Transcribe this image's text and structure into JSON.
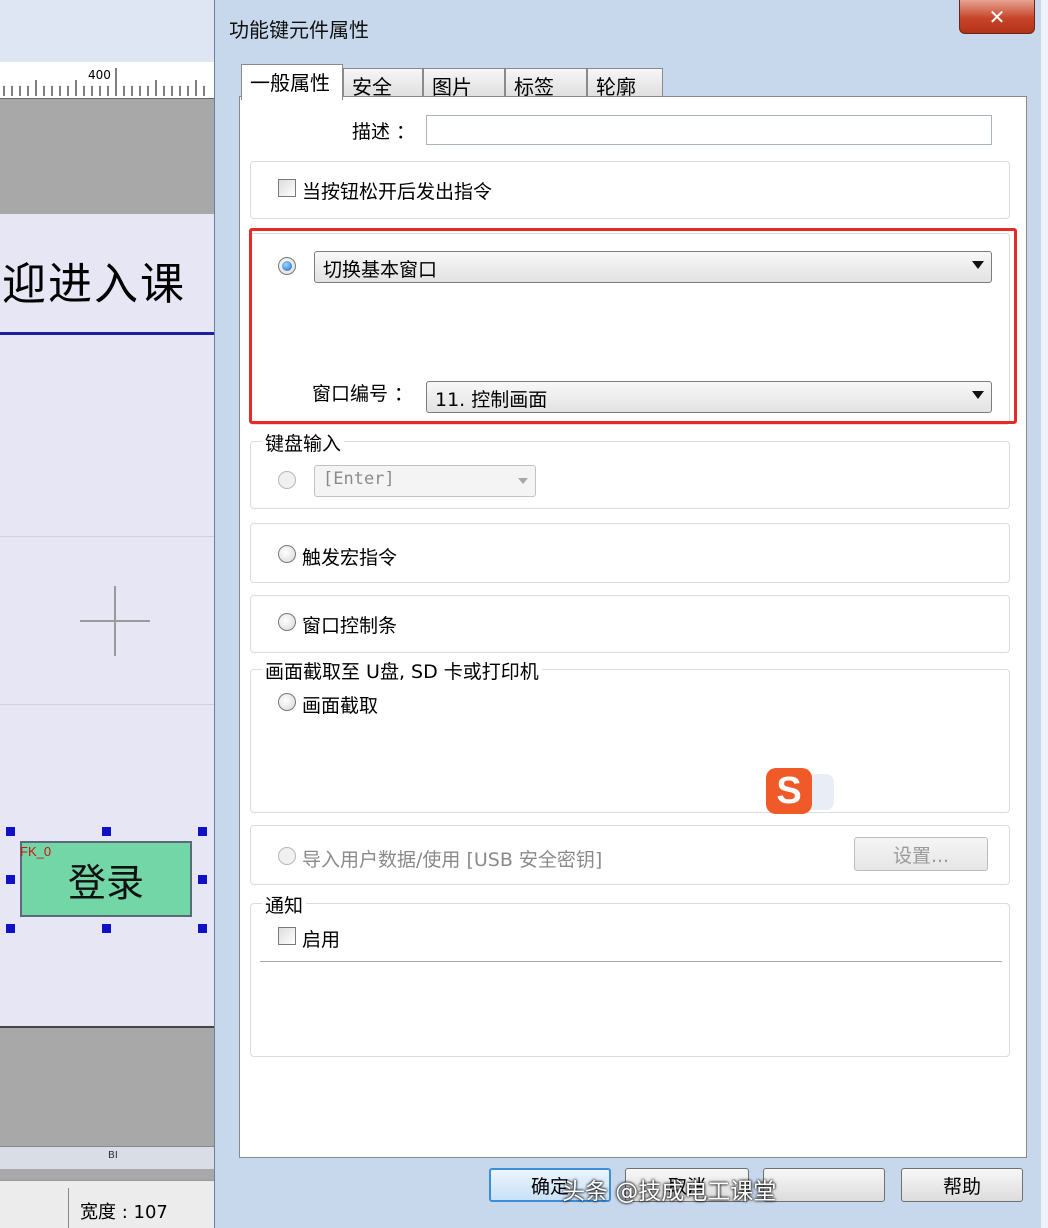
{
  "editor": {
    "ruler_label": "400",
    "canvas_title": "迎进入课",
    "button_tag": "FK_0",
    "button_label": "登录",
    "bottom_label": "BI",
    "status_text": "宽度 : 107"
  },
  "dialog": {
    "title": "功能键元件属性",
    "close_label": "✕",
    "tabs": [
      "一般属性",
      "安全",
      "图片",
      "标签",
      "轮廓"
    ],
    "description_label": "描述 ：",
    "description_value": "",
    "release_checkbox_label": "当按钮松开后发出指令",
    "switch_window_value": "切换基本窗口",
    "window_number_label": "窗口编号 ：",
    "window_number_value": "11. 控制画面",
    "keyboard_group_label": "键盘输入",
    "keyboard_value": "[Enter]",
    "macro_label": "触发宏指令",
    "window_bar_label": "窗口控制条",
    "screenshot_group_label": "画面截取至 U盘, SD 卡或打印机",
    "screenshot_label": "画面截取",
    "import_label": "导入用户数据/使用 [USB 安全密钥]",
    "settings_label": "设置...",
    "notify_group_label": "通知",
    "notify_enable_label": "启用",
    "ok_label": "确定",
    "cancel_label": "取消",
    "help_label": "帮助"
  },
  "watermark": "头条 @技成电工课堂",
  "colors": {
    "highlight": "#e52a2a",
    "canvas": "#e7e6f4",
    "button_fill": "#72d6a6"
  }
}
